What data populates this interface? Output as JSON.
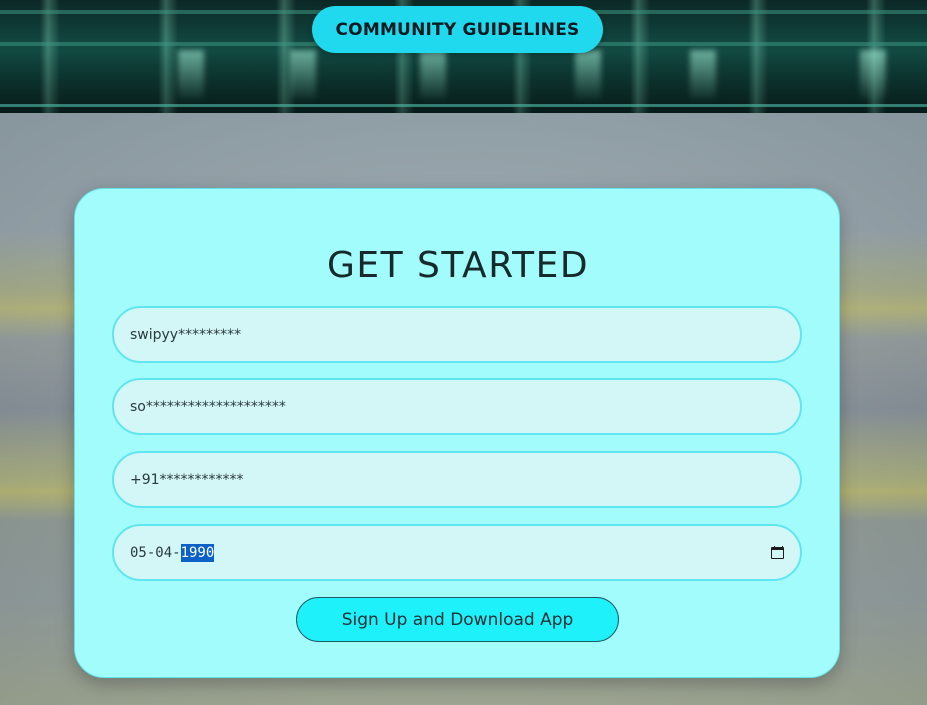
{
  "header": {
    "guidelines_label": "COMMUNITY GUIDELINES"
  },
  "form": {
    "title": "GET STARTED",
    "username_value": "swipyy*********",
    "email_value": "so********************",
    "phone_value": "+91************",
    "dob": {
      "day_month": "05-04-",
      "year_selected": "1990"
    },
    "submit_label": "Sign Up and Download App"
  },
  "colors": {
    "accent": "#21d9ef",
    "card_bg": "#a2fcfc",
    "field_bg": "#d3f6f6",
    "field_border": "#5fe6ee",
    "selection": "#0a62c7"
  },
  "icons": {
    "date_picker": "calendar-icon"
  }
}
